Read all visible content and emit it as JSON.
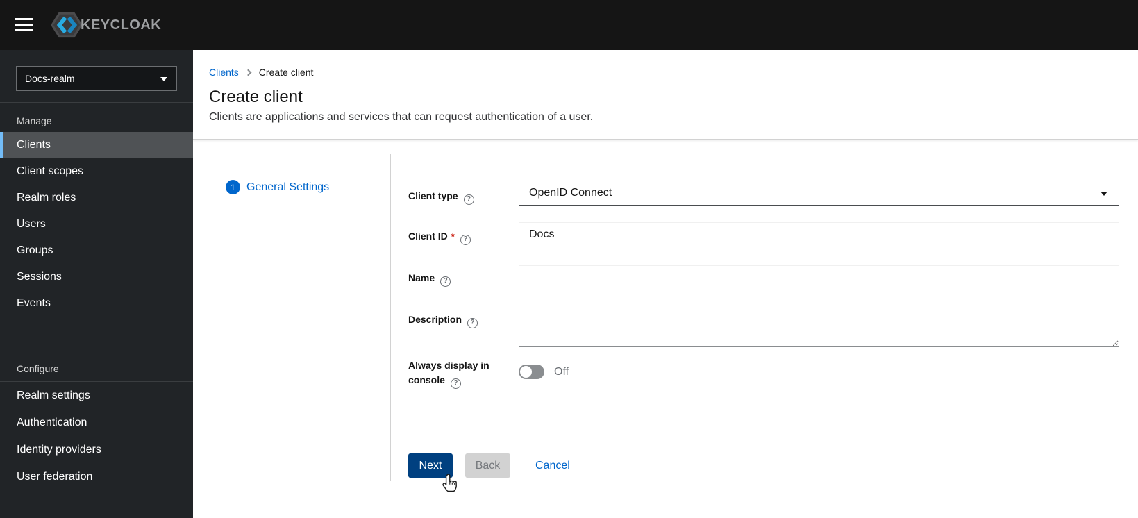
{
  "topbar": {
    "logo_text": "KEYCLOAK"
  },
  "sidebar": {
    "realm_selector": {
      "value": "Docs-realm"
    },
    "groups": [
      {
        "title": "Manage",
        "items": [
          {
            "label": "Clients",
            "selected": true
          },
          {
            "label": "Client scopes",
            "selected": false
          },
          {
            "label": "Realm roles",
            "selected": false
          },
          {
            "label": "Users",
            "selected": false
          },
          {
            "label": "Groups",
            "selected": false
          },
          {
            "label": "Sessions",
            "selected": false
          },
          {
            "label": "Events",
            "selected": false
          }
        ]
      },
      {
        "title": "Configure",
        "items": [
          {
            "label": "Realm settings",
            "selected": false
          },
          {
            "label": "Authentication",
            "selected": false
          },
          {
            "label": "Identity providers",
            "selected": false
          },
          {
            "label": "User federation",
            "selected": false
          }
        ]
      }
    ]
  },
  "breadcrumb": {
    "items": [
      {
        "label": "Clients"
      },
      {
        "label": "Create client"
      }
    ]
  },
  "header": {
    "title": "Create client",
    "description": "Clients are applications and services that can request authentication of a user."
  },
  "wizard": {
    "steps": [
      {
        "number": "1",
        "label": "General Settings"
      }
    ]
  },
  "form": {
    "client_type": {
      "label": "Client type",
      "value": "OpenID Connect"
    },
    "client_id": {
      "label": "Client ID",
      "required_marker": "*",
      "value": "Docs"
    },
    "name": {
      "label": "Name",
      "value": ""
    },
    "description": {
      "label": "Description",
      "value": ""
    },
    "always_display": {
      "label": "Always display in console",
      "state_label": "Off"
    }
  },
  "actions": {
    "next": "Next",
    "back": "Back",
    "cancel": "Cancel"
  },
  "colors": {
    "link_blue": "#0066cc",
    "primary_button_bg": "#004080",
    "nav_current_indicator": "#73bcf7",
    "nav_current_bg": "#4f5255",
    "required_red": "#c9190b",
    "topbar_bg": "#151515",
    "sidebar_bg": "#212427",
    "logo_blue": "#29abe2"
  }
}
